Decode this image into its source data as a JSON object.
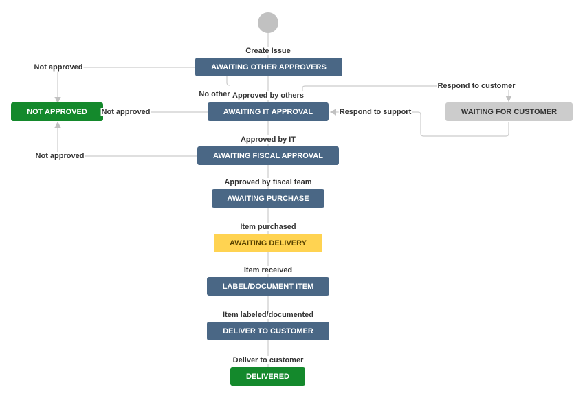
{
  "colors": {
    "status": "#4a6785",
    "done": "#14892c",
    "waiting": "#cccccc",
    "delivery": "#ffd351",
    "line": "#cccccc",
    "start": "#c1c1c1"
  },
  "nodes": {
    "awaiting_other_approvers": "AWAITING OTHER APPROVERS",
    "not_approved": "NOT APPROVED",
    "awaiting_it_approval": "AWAITING IT APPROVAL",
    "waiting_for_customer": "WAITING FOR CUSTOMER",
    "awaiting_fiscal_approval": "AWAITING FISCAL APPROVAL",
    "awaiting_purchase": "AWAITING PURCHASE",
    "awaiting_delivery": "AWAITING DELIVERY",
    "label_document_item": "LABEL/DOCUMENT ITEM",
    "deliver_to_customer": "DELIVER TO CUSTOMER",
    "delivered": "DELIVERED"
  },
  "transitions": {
    "create_issue": "Create Issue",
    "not_approved_1": "Not approved",
    "no_other": "No other",
    "approved_by_others": "Approved by others",
    "respond_to_customer": "Respond to customer",
    "not_approved_2": "Not approved",
    "respond_to_support": "Respond to support",
    "approved_by_it": "Approved by IT",
    "not_approved_3": "Not approved",
    "approved_by_fiscal_team": "Approved by fiscal team",
    "item_purchased": "Item purchased",
    "item_received": "Item received",
    "item_labeled_documented": "Item labeled/documented",
    "deliver_to_customer": "Deliver to customer"
  }
}
